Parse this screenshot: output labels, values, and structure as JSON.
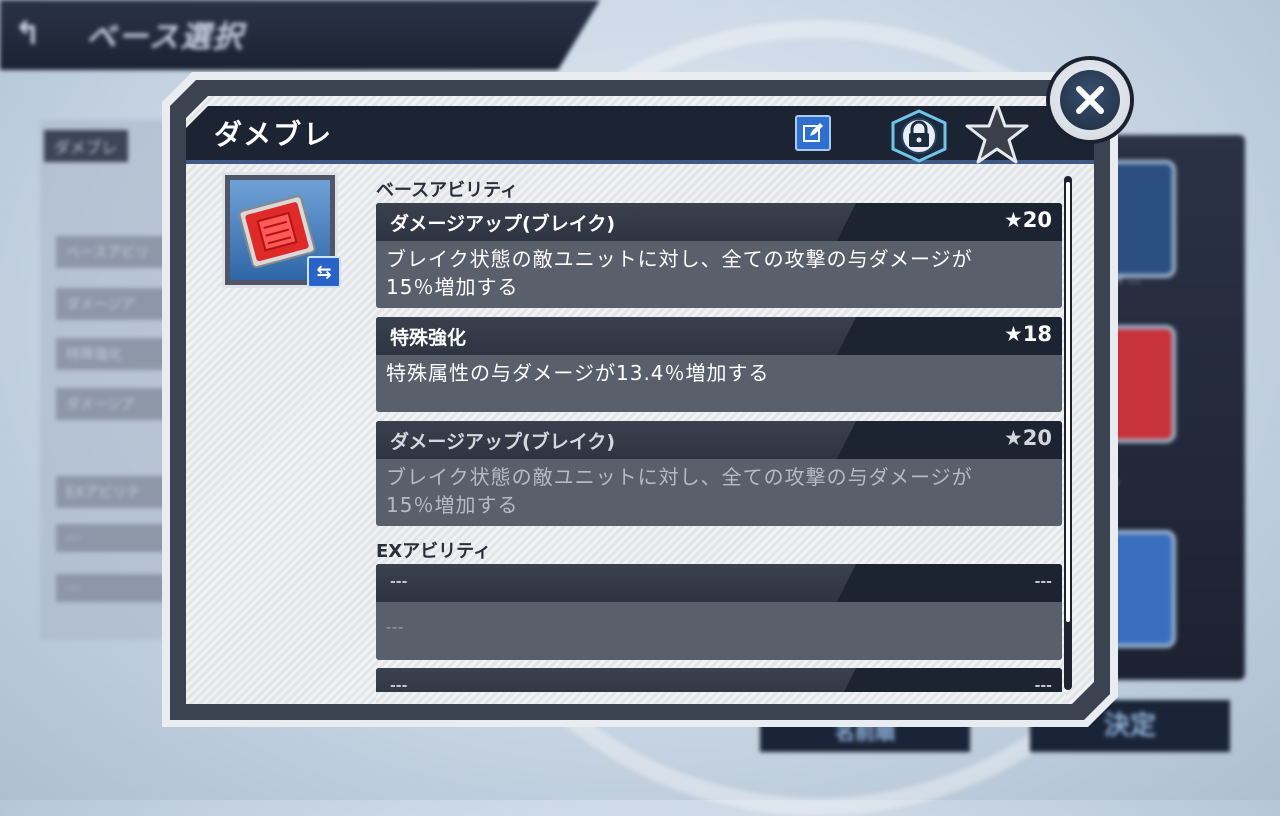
{
  "background": {
    "screen_title": "ベース選択",
    "left_tag": "ダメブレ",
    "left_rows": [
      "ベースアビリ",
      "ダメージア",
      "特殊強化",
      "ダメージア",
      "EXアビリテ",
      "---",
      "---"
    ],
    "right_label_1": "ティ…",
    "right_label_2": "レ",
    "button_left": "名前順",
    "button_right": "決定"
  },
  "dialog": {
    "title": "ダメブレ",
    "icons": {
      "edit": "edit-icon",
      "lock": "lock-icon",
      "favorite": "star-icon",
      "close": "close-icon",
      "swap": "swap-icon"
    },
    "base_ability_label": "ベースアビリティ",
    "ex_ability_label": "EXアビリティ",
    "base_abilities": [
      {
        "name": "ダメージアップ(ブレイク)",
        "cost": "★20",
        "desc_line1": "ブレイク状態の敵ユニットに対し、全ての攻撃の与ダメージが",
        "desc_line2": "15％増加する"
      },
      {
        "name": "特殊強化",
        "cost": "★18",
        "desc_line1": "特殊属性の与ダメージが13.4％増加する",
        "desc_line2": ""
      },
      {
        "name": "ダメージアップ(ブレイク)",
        "cost": "★20",
        "desc_line1": "ブレイク状態の敵ユニットに対し、全ての攻撃の与ダメージが",
        "desc_line2": "15％増加する"
      }
    ],
    "ex_abilities": [
      {
        "name": "---",
        "cost": "---",
        "desc": "---"
      },
      {
        "name": "---",
        "cost": "---"
      }
    ]
  },
  "colors": {
    "header_bg": "#1c2434",
    "card_bg": "#5a5f6c",
    "accent_blue": "#2f6fd0"
  }
}
